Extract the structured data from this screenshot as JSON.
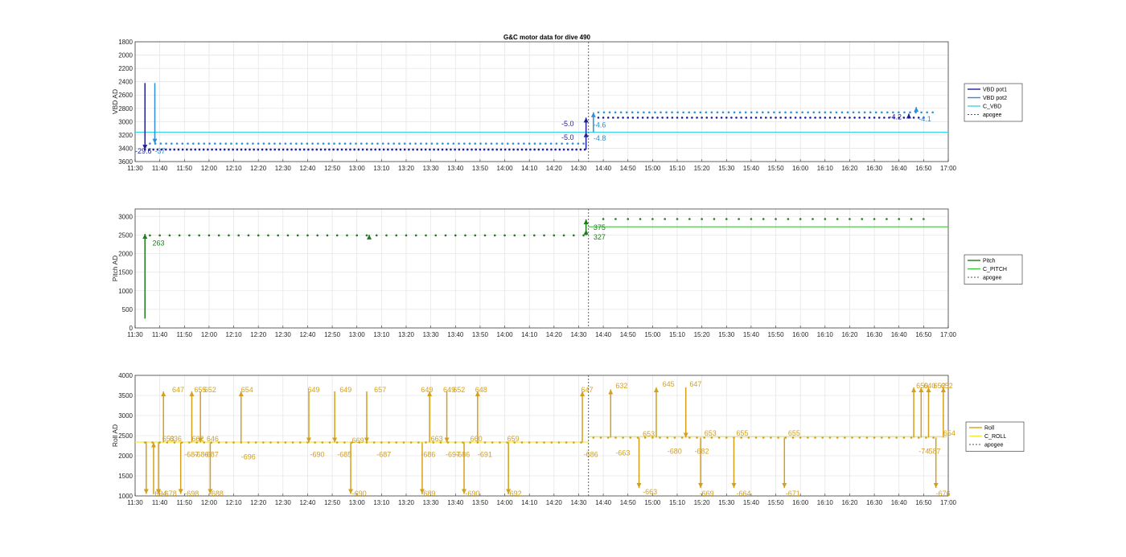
{
  "figure": {
    "title": "G&C motor data for dive 490"
  },
  "colors": {
    "vbd_pot1": "#1f1f9a",
    "vbd_pot2": "#2e8fd8",
    "c_vbd": "#3fd3e6",
    "pitch": "#1e7b1e",
    "c_pitch": "#3cc43c",
    "roll": "#d4a01c",
    "c_roll": "#f2ea3a",
    "apogee": "#555555",
    "grid": "#e6e6e6"
  },
  "chart_data": [
    {
      "type": "scatter",
      "title": "G&C motor data for dive 490",
      "ylabel": "VBD AD",
      "xlabel": "",
      "x_ticks": [
        "11:30",
        "11:40",
        "11:50",
        "12:00",
        "12:10",
        "12:20",
        "12:30",
        "12:40",
        "12:50",
        "13:00",
        "13:10",
        "13:20",
        "13:30",
        "13:40",
        "13:50",
        "14:00",
        "14:10",
        "14:20",
        "14:30",
        "14:40",
        "14:50",
        "15:00",
        "15:10",
        "15:20",
        "15:30",
        "15:40",
        "15:50",
        "16:00",
        "16:10",
        "16:20",
        "16:30",
        "16:40",
        "16:50",
        "17:00"
      ],
      "xlim": [
        690,
        1020
      ],
      "ylim": [
        1800,
        3600
      ],
      "y_reversed": true,
      "y_ticks": [
        "1800",
        "2000",
        "2200",
        "2400",
        "2600",
        "2800",
        "3000",
        "3200",
        "3400",
        "3600"
      ],
      "grid": true,
      "legend": {
        "position": "right",
        "entries": [
          "VBD pot1",
          "VBD pot2",
          "C_VBD",
          "apogee"
        ]
      },
      "apogee_min": 874,
      "c_vbd_value": 3160,
      "series": [
        {
          "name": "VBD pot1",
          "segments": [
            {
              "x_start": 694,
              "x_end": 874,
              "step": 1.7,
              "y": 3420
            },
            {
              "x_start": 878,
              "x_end": 1010,
              "step": 2.0,
              "y": 2940
            }
          ]
        },
        {
          "name": "VBD pot2",
          "segments": [
            {
              "x_start": 696,
              "x_end": 874,
              "step": 2.2,
              "y": 3330
            },
            {
              "x_start": 878,
              "x_end": 1014,
              "step": 2.3,
              "y": 2860
            }
          ]
        }
      ],
      "events": [
        {
          "x": 694,
          "from": 2420,
          "to": 3420,
          "series": "VBD pot1"
        },
        {
          "x": 698,
          "from": 2420,
          "to": 3330,
          "series": "VBD pot2"
        },
        {
          "x": 873,
          "from": 3420,
          "to": 3160,
          "series": "VBD pot1"
        },
        {
          "x": 873,
          "from": 3160,
          "to": 2940,
          "series": "VBD pot1"
        },
        {
          "x": 876,
          "from": 3160,
          "to": 2860,
          "series": "VBD pot2"
        },
        {
          "x": 1004,
          "from": 2940,
          "to": 2880,
          "series": "VBD pot1"
        },
        {
          "x": 1007,
          "from": 2860,
          "to": 2780,
          "series": "VBD pot2"
        }
      ],
      "labels": [
        {
          "x": 690,
          "y": 3440,
          "text": "-29.6",
          "series": "VBD pot1"
        },
        {
          "x": 698,
          "y": 3440,
          "text": "-37",
          "series": "VBD pot2"
        },
        {
          "x": 863,
          "y": 3030,
          "text": "-5.0",
          "series": "VBD pot1"
        },
        {
          "x": 863,
          "y": 3240,
          "text": "-5.0",
          "series": "VBD pot1"
        },
        {
          "x": 876,
          "y": 3050,
          "text": "-4.6",
          "series": "VBD pot2"
        },
        {
          "x": 876,
          "y": 3250,
          "text": "-4.8",
          "series": "VBD pot2"
        },
        {
          "x": 996,
          "y": 2930,
          "text": "-4.2",
          "series": "VBD pot1"
        },
        {
          "x": 1008,
          "y": 2960,
          "text": "-4.1",
          "series": "VBD pot2"
        }
      ]
    },
    {
      "type": "scatter",
      "ylabel": "Pitch AD",
      "xlabel": "",
      "x_ticks": [
        "11:30",
        "11:40",
        "11:50",
        "12:00",
        "12:10",
        "12:20",
        "12:30",
        "12:40",
        "12:50",
        "13:00",
        "13:10",
        "13:20",
        "13:30",
        "13:40",
        "13:50",
        "14:00",
        "14:10",
        "14:20",
        "14:30",
        "14:40",
        "14:50",
        "15:00",
        "15:10",
        "15:20",
        "15:30",
        "15:40",
        "15:50",
        "16:00",
        "16:10",
        "16:20",
        "16:30",
        "16:40",
        "16:50",
        "17:00"
      ],
      "xlim": [
        690,
        1020
      ],
      "ylim": [
        0,
        3200
      ],
      "y_ticks": [
        "0",
        "500",
        "1000",
        "1500",
        "2000",
        "2500",
        "3000"
      ],
      "grid": true,
      "legend": {
        "position": "right",
        "entries": [
          "Pitch",
          "C_PITCH",
          "apogee"
        ]
      },
      "apogee_min": 874,
      "c_pitch_value": 2720,
      "series": [
        {
          "name": "Pitch",
          "segments": [
            {
              "x_start": 696,
              "x_end": 872,
              "step": 4,
              "y": 2490
            },
            {
              "x_start": 880,
              "x_end": 1012,
              "step": 5,
              "y": 2930
            }
          ]
        }
      ],
      "events": [
        {
          "x": 694,
          "from": 250,
          "to": 2530,
          "series": "Pitch"
        },
        {
          "x": 873,
          "from": 2490,
          "to": 2640,
          "series": "Pitch"
        },
        {
          "x": 873,
          "from": 2640,
          "to": 2920,
          "series": "Pitch"
        },
        {
          "x": 785,
          "from": 2490,
          "to": 2510,
          "series": "Pitch"
        }
      ],
      "labels": [
        {
          "x": 697,
          "y": 2280,
          "text": "263",
          "series": "Pitch"
        },
        {
          "x": 876,
          "y": 2700,
          "text": "375",
          "series": "Pitch"
        },
        {
          "x": 876,
          "y": 2440,
          "text": "327",
          "series": "Pitch"
        }
      ]
    },
    {
      "type": "scatter",
      "ylabel": "Roll AD",
      "xlabel": "",
      "x_ticks": [
        "11:30",
        "11:40",
        "11:50",
        "12:00",
        "12:10",
        "12:20",
        "12:30",
        "12:40",
        "12:50",
        "13:00",
        "13:10",
        "13:20",
        "13:30",
        "13:40",
        "13:50",
        "14:00",
        "14:10",
        "14:20",
        "14:30",
        "14:40",
        "14:50",
        "15:00",
        "15:10",
        "15:20",
        "15:30",
        "15:40",
        "15:50",
        "16:00",
        "16:10",
        "16:20",
        "16:30",
        "16:40",
        "16:50",
        "17:00"
      ],
      "xlim": [
        690,
        1020
      ],
      "ylim": [
        1000,
        4000
      ],
      "y_ticks": [
        "1000",
        "1500",
        "2000",
        "2500",
        "3000",
        "3500",
        "4000"
      ],
      "grid": true,
      "legend": {
        "position": "right",
        "entries": [
          "Roll",
          "C_ROLL",
          "apogee"
        ]
      },
      "apogee_min": 874,
      "c_roll_value_before": 2340,
      "c_roll_value_after": 2470,
      "series": [
        {
          "name": "Roll",
          "segments": [
            {
              "x_start": 694,
              "x_end": 872,
              "step": 3,
              "y": 2330
            },
            {
              "x_start": 876,
              "x_end": 1016,
              "step": 3,
              "y": 2450
            }
          ]
        }
      ],
      "events": [
        {
          "x": 694.5,
          "from": 2350,
          "to": 1050,
          "series": "Roll"
        },
        {
          "x": 697.5,
          "from": 1050,
          "to": 2330,
          "series": "Roll"
        },
        {
          "x": 699.5,
          "from": 2330,
          "to": 1050,
          "series": "Roll"
        },
        {
          "x": 701.5,
          "from": 2330,
          "to": 3600,
          "series": "Roll"
        },
        {
          "x": 708.5,
          "from": 2330,
          "to": 1050,
          "series": "Roll"
        },
        {
          "x": 713,
          "from": 2330,
          "to": 3600,
          "series": "Roll"
        },
        {
          "x": 716.5,
          "from": 3600,
          "to": 2330,
          "series": "Roll"
        },
        {
          "x": 720.5,
          "from": 2330,
          "to": 1050,
          "series": "Roll"
        },
        {
          "x": 733,
          "from": 2330,
          "to": 3600,
          "series": "Roll"
        },
        {
          "x": 760.5,
          "from": 3600,
          "to": 2330,
          "series": "Roll"
        },
        {
          "x": 771,
          "from": 3600,
          "to": 2330,
          "series": "Roll"
        },
        {
          "x": 777.5,
          "from": 2330,
          "to": 1050,
          "series": "Roll"
        },
        {
          "x": 784,
          "from": 3600,
          "to": 2330,
          "series": "Roll"
        },
        {
          "x": 806.5,
          "from": 2330,
          "to": 1050,
          "series": "Roll"
        },
        {
          "x": 809.5,
          "from": 2330,
          "to": 3600,
          "series": "Roll"
        },
        {
          "x": 816.5,
          "from": 3600,
          "to": 2330,
          "series": "Roll"
        },
        {
          "x": 823.5,
          "from": 2330,
          "to": 1050,
          "series": "Roll"
        },
        {
          "x": 829,
          "from": 2330,
          "to": 3600,
          "series": "Roll"
        },
        {
          "x": 841.5,
          "from": 2330,
          "to": 1050,
          "series": "Roll"
        },
        {
          "x": 871.5,
          "from": 2330,
          "to": 3600,
          "series": "Roll"
        },
        {
          "x": 883,
          "from": 2450,
          "to": 3650,
          "series": "Roll"
        },
        {
          "x": 894.5,
          "from": 2450,
          "to": 1200,
          "series": "Roll"
        },
        {
          "x": 901.5,
          "from": 2450,
          "to": 3700,
          "series": "Roll"
        },
        {
          "x": 913.5,
          "from": 3700,
          "to": 2450,
          "series": "Roll"
        },
        {
          "x": 919.5,
          "from": 2450,
          "to": 1200,
          "series": "Roll"
        },
        {
          "x": 933,
          "from": 2450,
          "to": 1200,
          "series": "Roll"
        },
        {
          "x": 953.5,
          "from": 2450,
          "to": 1200,
          "series": "Roll"
        },
        {
          "x": 1006,
          "from": 2450,
          "to": 3700,
          "series": "Roll"
        },
        {
          "x": 1009,
          "from": 2450,
          "to": 3700,
          "series": "Roll"
        },
        {
          "x": 1012,
          "from": 2450,
          "to": 3700,
          "series": "Roll"
        },
        {
          "x": 1015,
          "from": 2450,
          "to": 1200,
          "series": "Roll"
        },
        {
          "x": 1018,
          "from": 2450,
          "to": 3700,
          "series": "Roll"
        }
      ],
      "labels": [
        {
          "x": 701,
          "y": 2420,
          "text": "653"
        },
        {
          "x": 704,
          "y": 2420,
          "text": "636"
        },
        {
          "x": 705,
          "y": 3640,
          "text": "647"
        },
        {
          "x": 710,
          "y": 2030,
          "text": "-687"
        },
        {
          "x": 713,
          "y": 2420,
          "text": "662"
        },
        {
          "x": 714,
          "y": 3640,
          "text": "655"
        },
        {
          "x": 718,
          "y": 3640,
          "text": "652"
        },
        {
          "x": 719,
          "y": 2420,
          "text": "646"
        },
        {
          "x": 714,
          "y": 2030,
          "text": "-686"
        },
        {
          "x": 718,
          "y": 2030,
          "text": "-687"
        },
        {
          "x": 733,
          "y": 3640,
          "text": "654"
        },
        {
          "x": 733,
          "y": 1970,
          "text": "-696"
        },
        {
          "x": 760,
          "y": 3640,
          "text": "649"
        },
        {
          "x": 761,
          "y": 2030,
          "text": "-690"
        },
        {
          "x": 773,
          "y": 3640,
          "text": "649"
        },
        {
          "x": 772,
          "y": 2030,
          "text": "-685"
        },
        {
          "x": 778,
          "y": 2380,
          "text": "669"
        },
        {
          "x": 787,
          "y": 3640,
          "text": "657"
        },
        {
          "x": 788,
          "y": 2030,
          "text": "-687"
        },
        {
          "x": 806,
          "y": 3640,
          "text": "649"
        },
        {
          "x": 806,
          "y": 2030,
          "text": "-686"
        },
        {
          "x": 810,
          "y": 2420,
          "text": "663"
        },
        {
          "x": 815,
          "y": 3640,
          "text": "649"
        },
        {
          "x": 819,
          "y": 3640,
          "text": "652"
        },
        {
          "x": 816,
          "y": 2030,
          "text": "-697"
        },
        {
          "x": 820,
          "y": 2030,
          "text": "-686"
        },
        {
          "x": 826,
          "y": 2420,
          "text": "660"
        },
        {
          "x": 828,
          "y": 3640,
          "text": "648"
        },
        {
          "x": 829,
          "y": 2030,
          "text": "-691"
        },
        {
          "x": 841,
          "y": 2420,
          "text": "659"
        },
        {
          "x": 871,
          "y": 3640,
          "text": "647"
        },
        {
          "x": 872,
          "y": 2030,
          "text": "-686"
        },
        {
          "x": 885,
          "y": 3740,
          "text": "632"
        },
        {
          "x": 885,
          "y": 2070,
          "text": "-663"
        },
        {
          "x": 896,
          "y": 2540,
          "text": "653"
        },
        {
          "x": 904,
          "y": 3780,
          "text": "645"
        },
        {
          "x": 906,
          "y": 2110,
          "text": "-680"
        },
        {
          "x": 915,
          "y": 3780,
          "text": "647"
        },
        {
          "x": 917,
          "y": 2110,
          "text": "-682"
        },
        {
          "x": 921,
          "y": 2560,
          "text": "653"
        },
        {
          "x": 934,
          "y": 2560,
          "text": "655"
        },
        {
          "x": 955,
          "y": 2560,
          "text": "655"
        },
        {
          "x": 1007,
          "y": 3740,
          "text": "650"
        },
        {
          "x": 1010,
          "y": 3740,
          "text": "640"
        },
        {
          "x": 1014,
          "y": 3740,
          "text": "652"
        },
        {
          "x": 1017,
          "y": 3740,
          "text": "652"
        },
        {
          "x": 1008,
          "y": 2110,
          "text": "-74"
        },
        {
          "x": 1012,
          "y": 2110,
          "text": "587"
        },
        {
          "x": 1018,
          "y": 2560,
          "text": "654"
        }
      ],
      "bottom_labels": [
        {
          "x": 697,
          "y": 1000,
          "text": "-694"
        },
        {
          "x": 701,
          "y": 1000,
          "text": "-678"
        },
        {
          "x": 710,
          "y": 1000,
          "text": "-698"
        },
        {
          "x": 720,
          "y": 1000,
          "text": "-688"
        },
        {
          "x": 778,
          "y": 1000,
          "text": "-690"
        },
        {
          "x": 806,
          "y": 1000,
          "text": "-689"
        },
        {
          "x": 824,
          "y": 1000,
          "text": "-690"
        },
        {
          "x": 841,
          "y": 1000,
          "text": "-692"
        },
        {
          "x": 896,
          "y": 1100,
          "text": "-663"
        },
        {
          "x": 919,
          "y": 1050,
          "text": "-669"
        },
        {
          "x": 934,
          "y": 1050,
          "text": "-664"
        },
        {
          "x": 954,
          "y": 1050,
          "text": "-671"
        },
        {
          "x": 1015,
          "y": 1050,
          "text": "-676"
        }
      ]
    }
  ]
}
